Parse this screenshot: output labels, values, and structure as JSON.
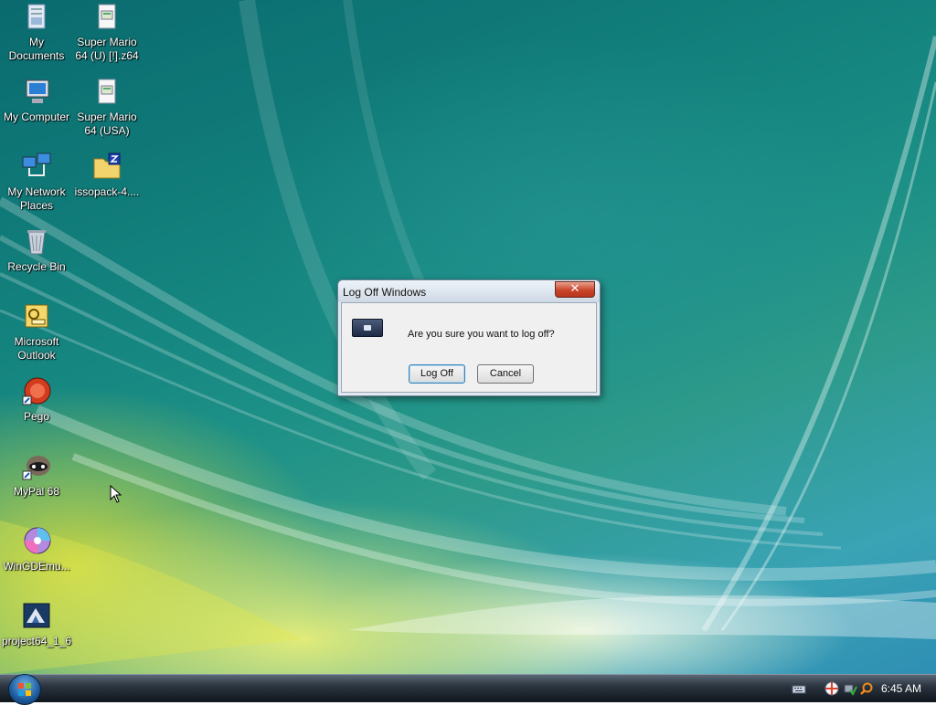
{
  "desktop": {
    "icons": [
      {
        "label": "My Documents",
        "icon": "documents-folder-icon"
      },
      {
        "label": "Super Mario 64 (U) [!].z64",
        "icon": "rom-file-icon"
      },
      {
        "label": "My Computer",
        "icon": "computer-icon"
      },
      {
        "label": "Super Mario 64 (USA)",
        "icon": "rom-file-icon"
      },
      {
        "label": "My Network Places",
        "icon": "network-icon"
      },
      {
        "label": "issopack-4....",
        "icon": "zip-folder-icon"
      },
      {
        "label": "Recycle Bin",
        "icon": "recycle-bin-icon"
      },
      {
        "label": "Microsoft Outlook",
        "icon": "outlook-icon"
      },
      {
        "label": "Pego",
        "icon": "pego-icon"
      },
      {
        "label": "MyPal 68",
        "icon": "mypal-icon"
      },
      {
        "label": "WinGDEmu...",
        "icon": "disc-emulator-icon"
      },
      {
        "label": "project64_1_6",
        "icon": "project64-icon"
      }
    ]
  },
  "dialog": {
    "title": "Log Off Windows",
    "close_label": "✕",
    "message": "Are you sure you want to log off?",
    "logoff_label": "Log Off",
    "cancel_label": "Cancel"
  },
  "taskbar": {
    "clock": "6:45 AM",
    "tray_icons": [
      "keyboard-icon",
      "security-center-icon",
      "safe-remove-icon",
      "search-icon"
    ]
  }
}
